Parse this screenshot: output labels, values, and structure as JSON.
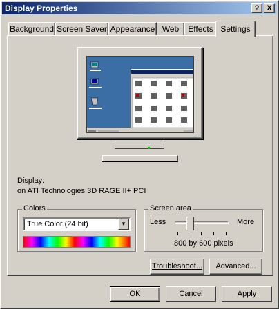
{
  "window": {
    "title": "Display Properties",
    "help_btn": "?",
    "close_btn": "X"
  },
  "tabs": [
    {
      "label": "Background"
    },
    {
      "label": "Screen Saver"
    },
    {
      "label": "Appearance"
    },
    {
      "label": "Web"
    },
    {
      "label": "Effects"
    },
    {
      "label": "Settings"
    }
  ],
  "active_tab": "Settings",
  "display": {
    "label": "Display:",
    "adapter": "on ATI Technologies 3D RAGE II+ PCI"
  },
  "colors": {
    "group_label": "Colors",
    "selected": "True Color (24 bit)"
  },
  "screen_area": {
    "group_label": "Screen area",
    "less": "Less",
    "more": "More",
    "resolution": "800 by 600 pixels",
    "slider_position": 0.25
  },
  "buttons": {
    "troubleshoot": "Troubleshoot...",
    "advanced": "Advanced...",
    "ok": "OK",
    "cancel": "Cancel",
    "apply": "Apply"
  },
  "colors_theme": {
    "titlebar_start": "#0a246a",
    "titlebar_end": "#a6caf0",
    "face": "#d4d0c8",
    "desktop": "#3a6ea5"
  }
}
